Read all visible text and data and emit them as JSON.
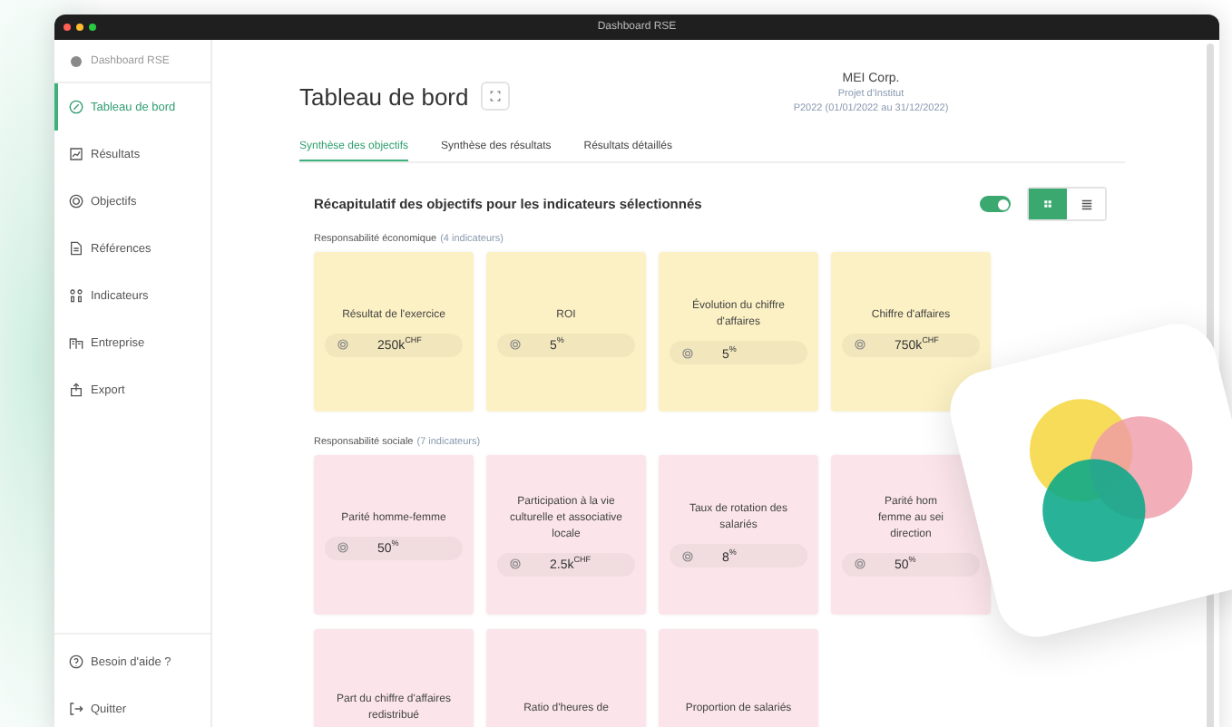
{
  "window": {
    "title": "Dashboard RSE"
  },
  "sidebar": {
    "brand": "Dashboard RSE",
    "items": [
      {
        "label": "Tableau de bord",
        "selected": true
      },
      {
        "label": "Résultats",
        "selected": false
      },
      {
        "label": "Objectifs",
        "selected": false
      },
      {
        "label": "Références",
        "selected": false
      },
      {
        "label": "Indicateurs",
        "selected": false
      },
      {
        "label": "Entreprise",
        "selected": false
      },
      {
        "label": "Export",
        "selected": false
      }
    ],
    "footer_items": [
      {
        "label": "Besoin d'aide ?"
      },
      {
        "label": "Quitter"
      }
    ]
  },
  "header": {
    "title": "Tableau de bord",
    "company": "MEI Corp.",
    "project": "Projet d'Institut",
    "period": "P2022 (01/01/2022 au 31/12/2022)"
  },
  "tabs": [
    {
      "label": "Synthèse des objectifs",
      "selected": true
    },
    {
      "label": "Synthèse des résultats",
      "selected": false
    },
    {
      "label": "Résultats détaillés",
      "selected": false
    }
  ],
  "summary": {
    "title": "Récapitulatif des objectifs pour les indicateurs sélectionnés",
    "toggle": {
      "on": true
    },
    "views": [
      {
        "selected": true
      },
      {
        "selected": false
      }
    ]
  },
  "sections": [
    {
      "name": "Responsabilité économique",
      "count": "(4 indicateurs)",
      "color": "#fcf1c4",
      "cards": [
        {
          "title": "Résultat de l'exercice",
          "value": "250k$^{CHF}$"
        },
        {
          "title": "ROI",
          "value": "5$^{%}$"
        },
        {
          "title": "Évolution du chiffre d'affaires",
          "value": "5$^{%}$"
        },
        {
          "title": "Chiffre d'affaires",
          "value": "750k$^{CHF}$"
        }
      ]
    },
    {
      "name": "Responsabilité sociale",
      "count": "(7 indicateurs)",
      "color": "#fbe5ea",
      "cards": [
        {
          "title": "Parité homme-femme",
          "value": "50$^{%}$"
        },
        {
          "title": "Participation à la vie culturelle et associative locale",
          "value": "2.5k$^{CHF}$"
        },
        {
          "title": "Taux de rotation des salariés",
          "value": "8$^{%}$"
        },
        {
          "title": "Parité hom\nfemme au sei\ndirection",
          "value": "50$^{%}$"
        },
        {
          "title": "Part du chiffre d'affaires redistribué"
        },
        {
          "title": "Ratio d'heures de"
        },
        {
          "title": "Proportion de salariés"
        }
      ]
    }
  ]
}
